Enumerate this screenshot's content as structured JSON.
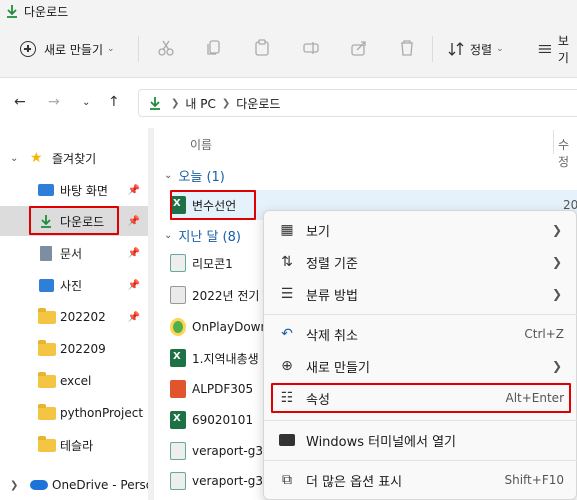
{
  "window": {
    "title": "다운로드"
  },
  "toolbar": {
    "new_label": "새로 만들기",
    "sort_label": "정렬",
    "view_label": "보기"
  },
  "address": {
    "crumbs": [
      "내 PC",
      "다운로드"
    ]
  },
  "nav": {
    "quick_access": "즐겨찾기",
    "items": [
      {
        "label": "바탕 화면"
      },
      {
        "label": "다운로드"
      },
      {
        "label": "문서"
      },
      {
        "label": "사진"
      },
      {
        "label": "202202"
      },
      {
        "label": "202209"
      },
      {
        "label": "excel"
      },
      {
        "label": "pythonProject"
      },
      {
        "label": "테슬라"
      }
    ],
    "onedrive": "OneDrive - Perso"
  },
  "content": {
    "col_name": "이름",
    "col_modified": "수정",
    "groups": [
      {
        "label": "오늘 (1)"
      },
      {
        "label": "지난 달 (8)"
      }
    ],
    "files": [
      {
        "name": "변수선언",
        "date": "20"
      },
      {
        "name": "리모콘1",
        "date": ""
      },
      {
        "name": "2022년 전기",
        "date": ""
      },
      {
        "name": "OnPlayDown",
        "date": ""
      },
      {
        "name": "1.지역내총생",
        "date": ""
      },
      {
        "name": "ALPDF305",
        "date": ""
      },
      {
        "name": "69020101",
        "date": ""
      },
      {
        "name": "veraport-g3-",
        "date": ""
      },
      {
        "name": "veraport-g3-",
        "date": ""
      }
    ]
  },
  "menu": {
    "items": [
      {
        "label": "보기",
        "shortcut": ""
      },
      {
        "label": "정렬 기준",
        "shortcut": ""
      },
      {
        "label": "분류 방법",
        "shortcut": ""
      },
      {
        "label": "삭제 취소",
        "shortcut": "Ctrl+Z"
      },
      {
        "label": "새로 만들기",
        "shortcut": ""
      },
      {
        "label": "속성",
        "shortcut": "Alt+Enter"
      },
      {
        "label": "Windows 터미널에서 열기",
        "shortcut": ""
      },
      {
        "label": "더 많은 옵션 표시",
        "shortcut": "Shift+F10"
      }
    ]
  },
  "colors": {
    "highlight": "#e00000",
    "accent": "#1b5fa5",
    "selected_row": "#e5f1fb"
  }
}
